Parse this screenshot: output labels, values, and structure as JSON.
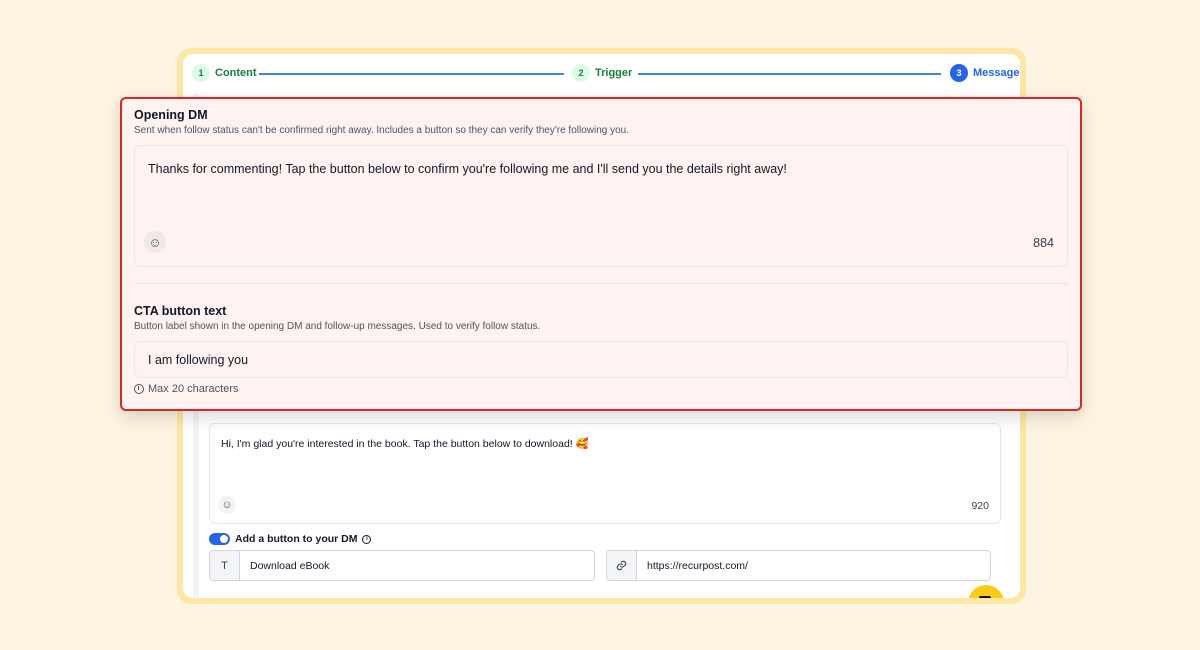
{
  "stepper": {
    "steps": [
      {
        "num": "1",
        "label": "Content"
      },
      {
        "num": "2",
        "label": "Trigger"
      },
      {
        "num": "3",
        "label": "Message"
      }
    ],
    "active_step": 3
  },
  "opening_dm": {
    "title": "Opening DM",
    "description": "Sent when follow status can't be confirmed right away. Includes a button so they can verify they're following you.",
    "message": "Thanks for commenting! Tap the button below to confirm you're following me and I'll send you the details right away!",
    "char_count": "884"
  },
  "cta": {
    "title": "CTA button text",
    "description": "Button label shown in the opening DM and follow-up messages. Used to verify follow status.",
    "value": "I am following you",
    "hint": "Max 20 characters"
  },
  "message": {
    "text": "Hi, I'm glad you're interested in the book. Tap the button below to download! 🥰",
    "char_count": "920"
  },
  "dm_button": {
    "toggle_label": "Add a button to your DM",
    "toggle_on": true,
    "text_addon": "T",
    "text_value": "Download eBook",
    "url_value": "https://recurpost.com/"
  },
  "colors": {
    "accent": "#2563eb",
    "step_done": "#15803d",
    "highlight_border": "#dc2626",
    "background": "#fdf5e1"
  },
  "icons": [
    "emoji-icon",
    "info-icon",
    "link-icon",
    "clock-icon",
    "chat-fab-icon"
  ]
}
